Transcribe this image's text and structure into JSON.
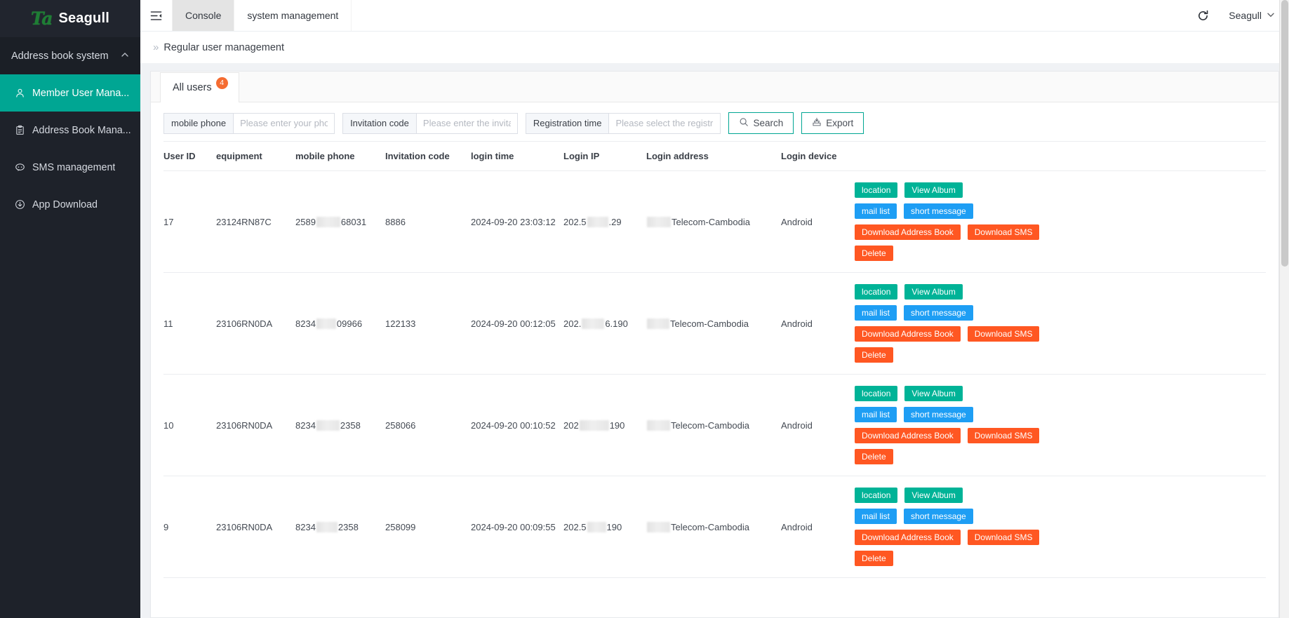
{
  "brand": {
    "mark": "Ta",
    "name": "Seagull"
  },
  "sidebar": {
    "group_label": "Address book system",
    "items": [
      {
        "label": "Member User Mana...",
        "icon": "user-icon",
        "active": true
      },
      {
        "label": "Address Book Mana...",
        "icon": "clipboard-icon",
        "active": false
      },
      {
        "label": "SMS management",
        "icon": "message-icon",
        "active": false
      },
      {
        "label": "App Download",
        "icon": "download-icon",
        "active": false
      }
    ]
  },
  "topbar": {
    "collapse_icon": "menu-collapse-icon",
    "tabs": [
      {
        "label": "Console",
        "selected": true
      },
      {
        "label": "system management",
        "selected": false
      }
    ],
    "refresh_icon": "refresh-icon",
    "user": "Seagull",
    "user_chevron": "chevron-down-icon"
  },
  "breadcrumb": {
    "separator": "»",
    "text": "Regular user management"
  },
  "tabstrip": {
    "tabs": [
      {
        "label": "All users",
        "badge": "4"
      }
    ]
  },
  "filters": {
    "phone": {
      "label": "mobile phone",
      "placeholder": "Please enter your phone",
      "value": ""
    },
    "invite": {
      "label": "Invitation code",
      "placeholder": "Please enter the invitatio",
      "value": ""
    },
    "regtime": {
      "label": "Registration time",
      "placeholder": "Please select the registr",
      "value": ""
    },
    "search_button": {
      "label": "Search",
      "icon": "search-icon"
    },
    "export_button": {
      "label": "Export",
      "icon": "export-icon"
    }
  },
  "table": {
    "columns": [
      "User ID",
      "equipment",
      "mobile phone",
      "Invitation code",
      "login time",
      "Login IP",
      "Login address",
      "Login device",
      ""
    ],
    "rows": [
      {
        "user_id": "17",
        "equipment": "23124RN87C",
        "phone_prefix": "2589",
        "phone_suffix": "68031",
        "phone_redact_w": 34,
        "invitation_code": "8886",
        "login_time": "2024-09-20 23:03:12",
        "ip_prefix": "202.5",
        "ip_suffix": ".29",
        "ip_redact_w": 30,
        "address_redact_w": 34,
        "address_text": "Telecom-Cambodia",
        "device": "Android"
      },
      {
        "user_id": "11",
        "equipment": "23106RN0DA",
        "phone_prefix": "8234",
        "phone_suffix": "09966",
        "phone_redact_w": 28,
        "invitation_code": "122133",
        "login_time": "2024-09-20 00:12:05",
        "ip_prefix": "202.",
        "ip_suffix": "6.190",
        "ip_redact_w": 32,
        "address_redact_w": 32,
        "address_text": "Telecom-Cambodia",
        "device": "Android"
      },
      {
        "user_id": "10",
        "equipment": "23106RN0DA",
        "phone_prefix": "8234",
        "phone_suffix": "2358",
        "phone_redact_w": 33,
        "invitation_code": "258066",
        "login_time": "2024-09-20 00:10:52",
        "ip_prefix": "202",
        "ip_suffix": "190",
        "ip_redact_w": 42,
        "address_redact_w": 33,
        "address_text": "Telecom-Cambodia",
        "device": "Android"
      },
      {
        "user_id": "9",
        "equipment": "23106RN0DA",
        "phone_prefix": "8234",
        "phone_suffix": "2358",
        "phone_redact_w": 30,
        "invitation_code": "258099",
        "login_time": "2024-09-20 00:09:55",
        "ip_prefix": "202.5",
        "ip_suffix": "190",
        "ip_redact_w": 27,
        "address_redact_w": 33,
        "address_text": "Telecom-Cambodia",
        "device": "Android"
      }
    ],
    "actions": [
      {
        "label": "location",
        "style": "teal"
      },
      {
        "label": "View Album",
        "style": "teal"
      },
      {
        "label": "mail list",
        "style": "blue"
      },
      {
        "label": "short message",
        "style": "blue"
      },
      {
        "label": "Download Address Book",
        "style": "orange"
      },
      {
        "label": "Download SMS",
        "style": "orange"
      },
      {
        "label": "Delete",
        "style": "orange"
      }
    ]
  },
  "colors": {
    "sidebar_bg": "#1e222a",
    "active_menu": "#00a693",
    "teal": "#00b397",
    "blue": "#1e9ef4",
    "orange": "#ff5722",
    "badge": "#f56c31"
  }
}
